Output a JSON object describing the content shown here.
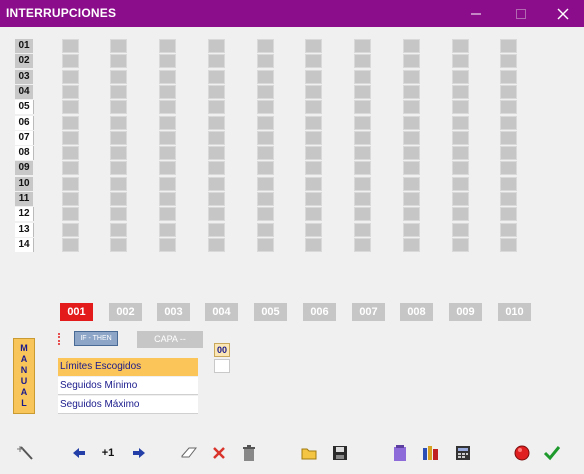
{
  "window": {
    "title": "INTERRUPCIONES"
  },
  "rows": [
    "01",
    "02",
    "03",
    "04",
    "05",
    "06",
    "07",
    "08",
    "09",
    "10",
    "11",
    "12",
    "13",
    "14"
  ],
  "row_styles": [
    "gray",
    "gray",
    "gray",
    "gray",
    "white",
    "white",
    "white",
    "white",
    "gray",
    "gray",
    "gray",
    "white",
    "white",
    "white"
  ],
  "columns": [
    "001",
    "002",
    "003",
    "004",
    "005",
    "006",
    "007",
    "008",
    "009",
    "010"
  ],
  "active_column": "001",
  "manual_label": [
    "M",
    "A",
    "N",
    "U",
    "A",
    "L"
  ],
  "buttons": {
    "if_then": "IF - THEN",
    "capa": "CAPA --"
  },
  "counter": {
    "value": "00"
  },
  "list": [
    "Límites Escogidos",
    "Seguidos Mínimo",
    "Seguidos Máximo"
  ],
  "toolbar": {
    "step_label": "+1"
  },
  "colors": {
    "title_bar": "#8b0d8b",
    "active_tab": "#e31b1b",
    "cell": "#c6c6c6",
    "highlight": "#fbc55a"
  }
}
